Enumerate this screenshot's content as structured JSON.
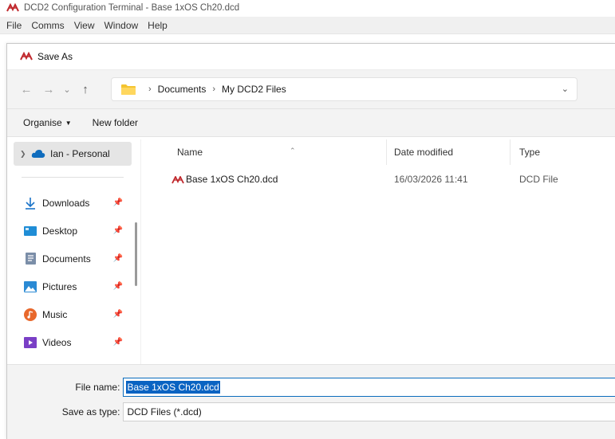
{
  "window": {
    "title": "DCD2 Configuration Terminal - Base 1xOS Ch20.dcd",
    "app_icon": "dcd-app-icon"
  },
  "menu": [
    "File",
    "Comms",
    "View",
    "Window",
    "Help"
  ],
  "dialog": {
    "title": "Save As",
    "nav": {
      "back_icon": "arrow-left-icon",
      "forward_icon": "arrow-right-icon",
      "recent_icon": "chevron-down-icon",
      "up_icon": "arrow-up-icon"
    },
    "breadcrumb": [
      "Documents",
      "My DCD2 Files"
    ],
    "toolbar": {
      "organise_label": "Organise",
      "new_folder_label": "New folder"
    },
    "sidebar": {
      "onedrive_label": "Ian - Personal",
      "quick_access": [
        {
          "label": "Downloads",
          "icon": "download-icon"
        },
        {
          "label": "Desktop",
          "icon": "desktop-icon"
        },
        {
          "label": "Documents",
          "icon": "documents-icon"
        },
        {
          "label": "Pictures",
          "icon": "pictures-icon"
        },
        {
          "label": "Music",
          "icon": "music-icon"
        },
        {
          "label": "Videos",
          "icon": "videos-icon"
        }
      ]
    },
    "columns": {
      "name": "Name",
      "date_modified": "Date modified",
      "type": "Type"
    },
    "files": [
      {
        "name": "Base 1xOS Ch20.dcd",
        "date_modified": "16/03/2026 11:41",
        "type": "DCD File"
      }
    ],
    "footer": {
      "file_name_label": "File name:",
      "file_name_value": "Base 1xOS Ch20.dcd",
      "save_as_type_label": "Save as type:",
      "save_as_type_value": "DCD Files (*.dcd)"
    }
  },
  "colors": {
    "accent": "#0a63c2",
    "app_icon_red": "#c0282d"
  }
}
